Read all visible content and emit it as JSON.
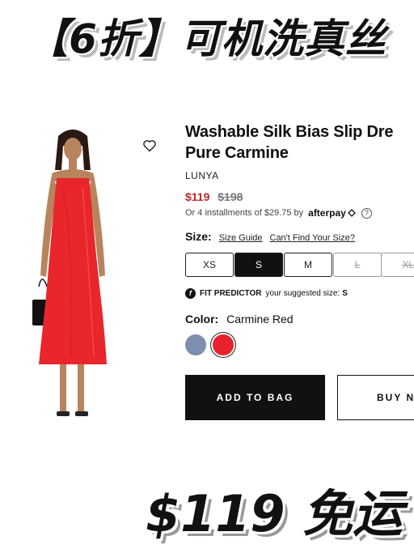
{
  "banner": {
    "top": "【6折】可机洗真丝",
    "bottom": "$119 免运"
  },
  "product": {
    "title_line1": "Washable Silk Bias Slip Dre",
    "title_line2": "Pure Carmine",
    "brand": "LUNYA",
    "price_sale": "$119",
    "price_original": "$198",
    "afterpay_text": "Or 4 installments of $29.75 by",
    "afterpay_logo": "afterpay",
    "help": "?"
  },
  "size": {
    "label": "Size:",
    "guide_link": "Size Guide",
    "cant_find_link": "Can't Find Your Size?",
    "options": [
      {
        "label": "XS",
        "state": "available"
      },
      {
        "label": "S",
        "state": "selected"
      },
      {
        "label": "M",
        "state": "available"
      },
      {
        "label": "L",
        "state": "unavailable"
      },
      {
        "label": "XL",
        "state": "unavailable"
      }
    ]
  },
  "fit_predictor": {
    "icon": "f",
    "title": "FIT PREDICTOR",
    "text": "your suggested size:",
    "value": "S"
  },
  "color": {
    "label": "Color:",
    "value": "Carmine Red",
    "swatches": [
      {
        "name": "blue-gray",
        "hex": "#7d8eae"
      },
      {
        "name": "carmine-red",
        "hex": "#e8222d"
      }
    ]
  },
  "actions": {
    "add_to_bag": "ADD TO BAG",
    "buy_now": "BUY N"
  },
  "colors": {
    "dress": "#e8262c",
    "sale_price": "#c0262b"
  }
}
